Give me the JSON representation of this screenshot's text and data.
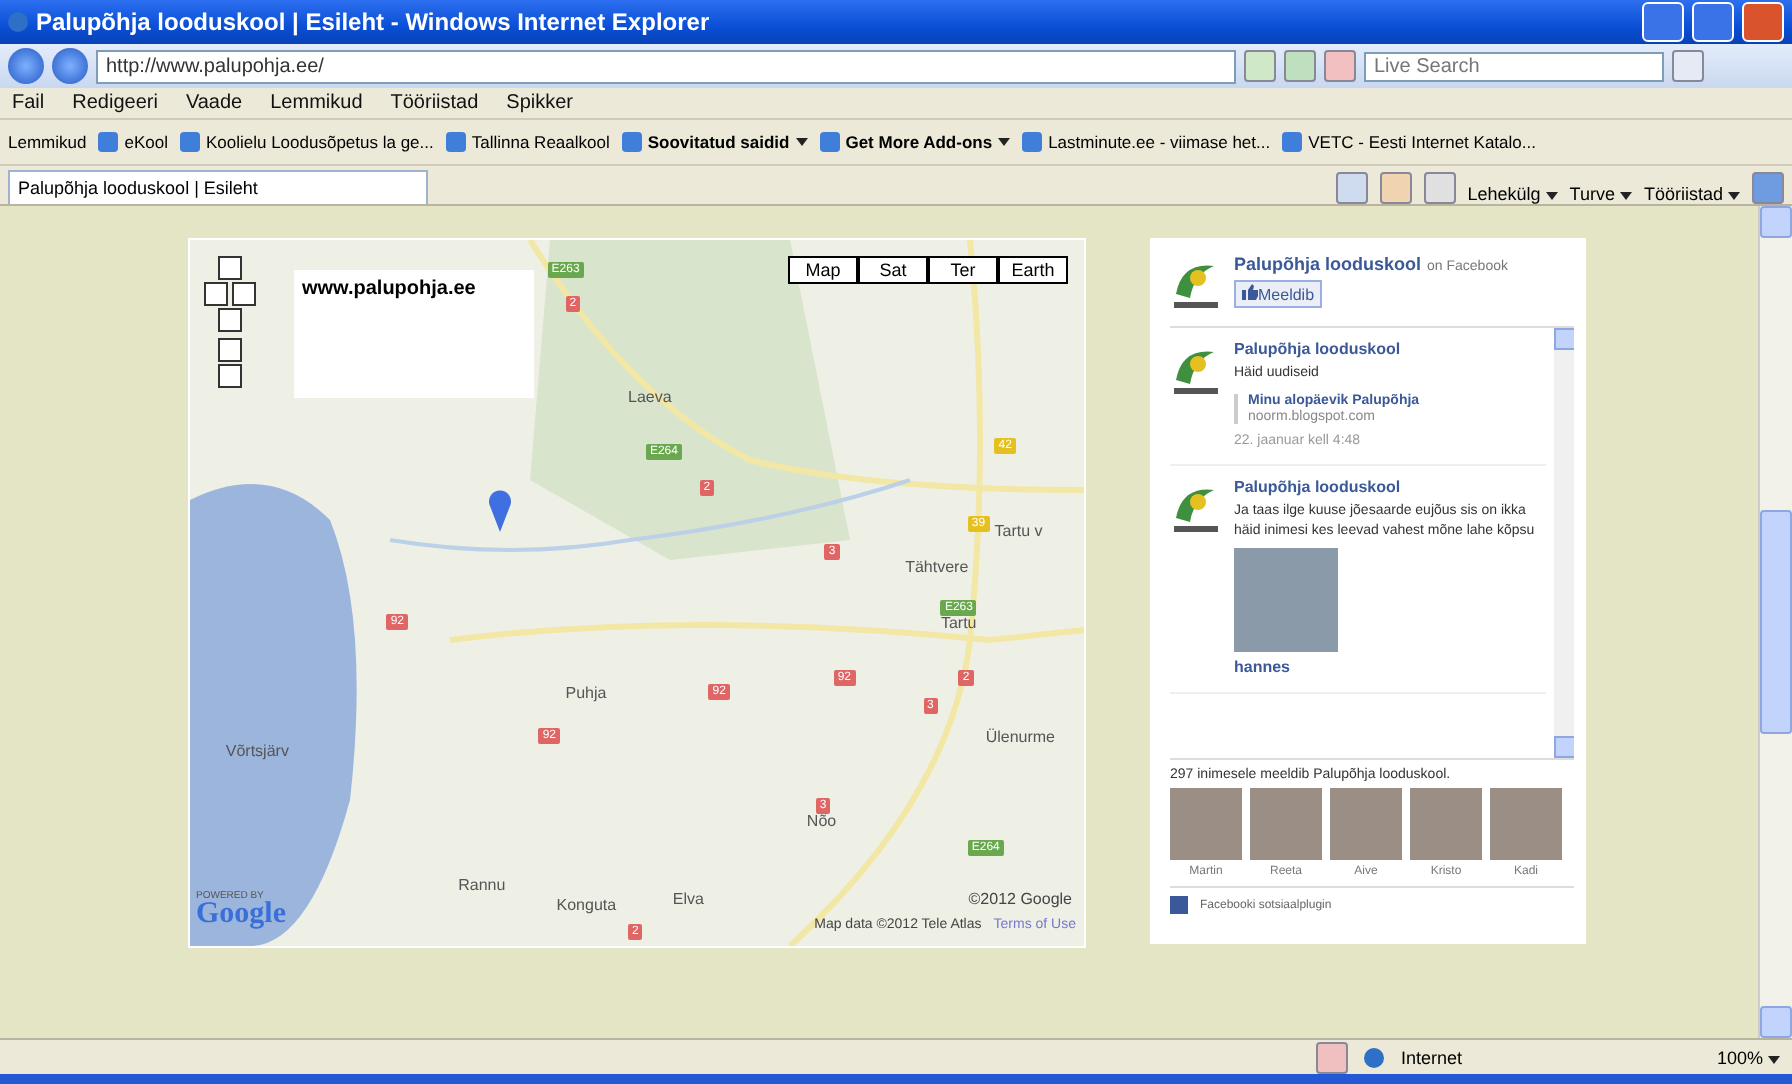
{
  "window": {
    "title": "Palupõhja looduskool | Esileht - Windows Internet Explorer"
  },
  "address_bar": {
    "url": "http://www.palupohja.ee/",
    "search_placeholder": "Live Search"
  },
  "menu": [
    "Fail",
    "Redigeeri",
    "Vaade",
    "Lemmikud",
    "Tööriistad",
    "Spikker"
  ],
  "favorites_bar": {
    "label": "Lemmikud",
    "items": [
      {
        "label": "eKool",
        "bold": false,
        "dropdown": false
      },
      {
        "label": "Koolielu Loodusõpetus la ge...",
        "bold": false,
        "dropdown": false
      },
      {
        "label": "Tallinna Reaalkool",
        "bold": false,
        "dropdown": false
      },
      {
        "label": "Soovitatud saidid",
        "bold": true,
        "dropdown": true
      },
      {
        "label": "Get More Add-ons",
        "bold": true,
        "dropdown": true
      },
      {
        "label": "Lastminute.ee - viimase het...",
        "bold": false,
        "dropdown": false
      },
      {
        "label": "VETC - Eesti Internet Katalo...",
        "bold": false,
        "dropdown": false
      }
    ]
  },
  "tabs": [
    {
      "label": "Palupõhja looduskool | Esileht",
      "selected": true
    }
  ],
  "command_bar": [
    "Lehekülg",
    "Turve",
    "Tööriistad"
  ],
  "map": {
    "title": "www.palupohja.ee",
    "map_types": [
      {
        "label": "Map",
        "selected": false
      },
      {
        "label": "Sat",
        "selected": false
      },
      {
        "label": "Ter",
        "selected": false
      },
      {
        "label": "Earth",
        "selected": false
      }
    ],
    "places": [
      "Laeva",
      "Tähtvere",
      "Tartu",
      "Tartu v",
      "Puhja",
      "Võrtsjärv",
      "Nõo",
      "Rannu",
      "Konguta",
      "Elva",
      "Ülenurme"
    ],
    "road_signs": [
      {
        "label": "E263",
        "color": "#6aa84f"
      },
      {
        "label": "2",
        "color": "#e06666"
      },
      {
        "label": "E264",
        "color": "#6aa84f"
      },
      {
        "label": "2",
        "color": "#e06666"
      },
      {
        "label": "42",
        "color": "#e6c020"
      },
      {
        "label": "39",
        "color": "#e6c020"
      },
      {
        "label": "3",
        "color": "#e06666"
      },
      {
        "label": "E263",
        "color": "#6aa84f"
      },
      {
        "label": "92",
        "color": "#e06666"
      },
      {
        "label": "92",
        "color": "#e06666"
      },
      {
        "label": "92",
        "color": "#e06666"
      },
      {
        "label": "92",
        "color": "#e06666"
      },
      {
        "label": "2",
        "color": "#e06666"
      },
      {
        "label": "3",
        "color": "#e06666"
      },
      {
        "label": "3",
        "color": "#e06666"
      },
      {
        "label": "E264",
        "color": "#6aa84f"
      },
      {
        "label": "2",
        "color": "#e06666"
      }
    ],
    "powered_by": "POWERED BY",
    "logo": "Google",
    "copyright": "©2012 Google",
    "data_credit": "Map data ©2012 Tele Atlas",
    "terms_link": "Terms of Use"
  },
  "facebook": {
    "page_name": "Palupõhja looduskool",
    "suffix": "on Facebook",
    "like_button": "Meeldib",
    "posts": [
      {
        "author": "Palupõhja looduskool",
        "text": "Häid uudiseid",
        "link_title": "Minu alopäevik Palupõhja",
        "link_url": "noorm.blogspot.com",
        "time": "22. jaanuar kell 4:48"
      },
      {
        "author": "Palupõhja looduskool",
        "text": "Ja taas ilge kuuse jõesaarde eujõus sis on ikka häid inimesi kes leevad vahest mõne lahe kõpsu",
        "photo_caption": "hannes"
      }
    ],
    "likes_text": "297 inimesele meeldib Palupõhja looduskool.",
    "fans": [
      "Martin",
      "Reeta",
      "Aive",
      "Kristo",
      "Kadi"
    ],
    "footer": "Facebooki sotsiaalplugin"
  },
  "status_bar": {
    "zone": "Internet",
    "zoom": "100%"
  }
}
